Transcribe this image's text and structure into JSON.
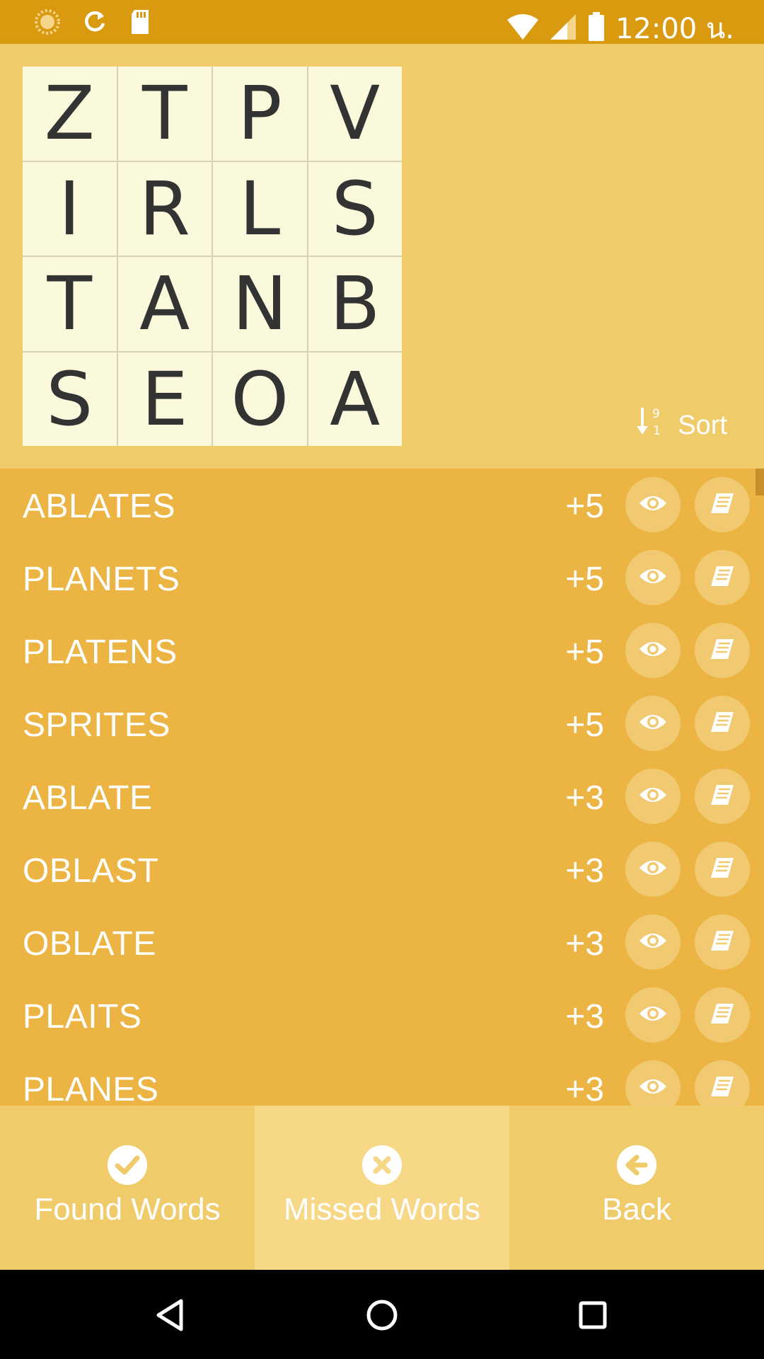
{
  "status_bar": {
    "time": "12:00 น.",
    "icons": [
      "loading-icon",
      "sync-icon",
      "sd-card-icon",
      "wifi-icon",
      "cell-signal-icon",
      "battery-icon"
    ]
  },
  "grid": {
    "letters": [
      "Z",
      "T",
      "P",
      "V",
      "I",
      "R",
      "L",
      "S",
      "T",
      "A",
      "N",
      "B",
      "S",
      "E",
      "O",
      "A"
    ]
  },
  "sort": {
    "label": "Sort",
    "icon": "sort-numeric-icon"
  },
  "words": [
    {
      "word": "ABLATES",
      "points": "+5"
    },
    {
      "word": "PLANETS",
      "points": "+5"
    },
    {
      "word": "PLATENS",
      "points": "+5"
    },
    {
      "word": "SPRITES",
      "points": "+5"
    },
    {
      "word": "ABLATE",
      "points": "+3"
    },
    {
      "word": "OBLAST",
      "points": "+3"
    },
    {
      "word": "OBLATE",
      "points": "+3"
    },
    {
      "word": "PLAITS",
      "points": "+3"
    },
    {
      "word": "PLANES",
      "points": "+3"
    }
  ],
  "bottom_nav": [
    {
      "label": "Found Words",
      "icon": "check-circle-icon",
      "active": false
    },
    {
      "label": "Missed Words",
      "icon": "x-circle-icon",
      "active": true
    },
    {
      "label": "Back",
      "icon": "back-arrow-icon",
      "active": false
    }
  ],
  "colors": {
    "status_bar": "#D99A10",
    "top_area": "#EFCB6A",
    "list_bg": "#ECB543",
    "cell_bg": "#FAF9DB",
    "active_tab": "#F7D887"
  }
}
